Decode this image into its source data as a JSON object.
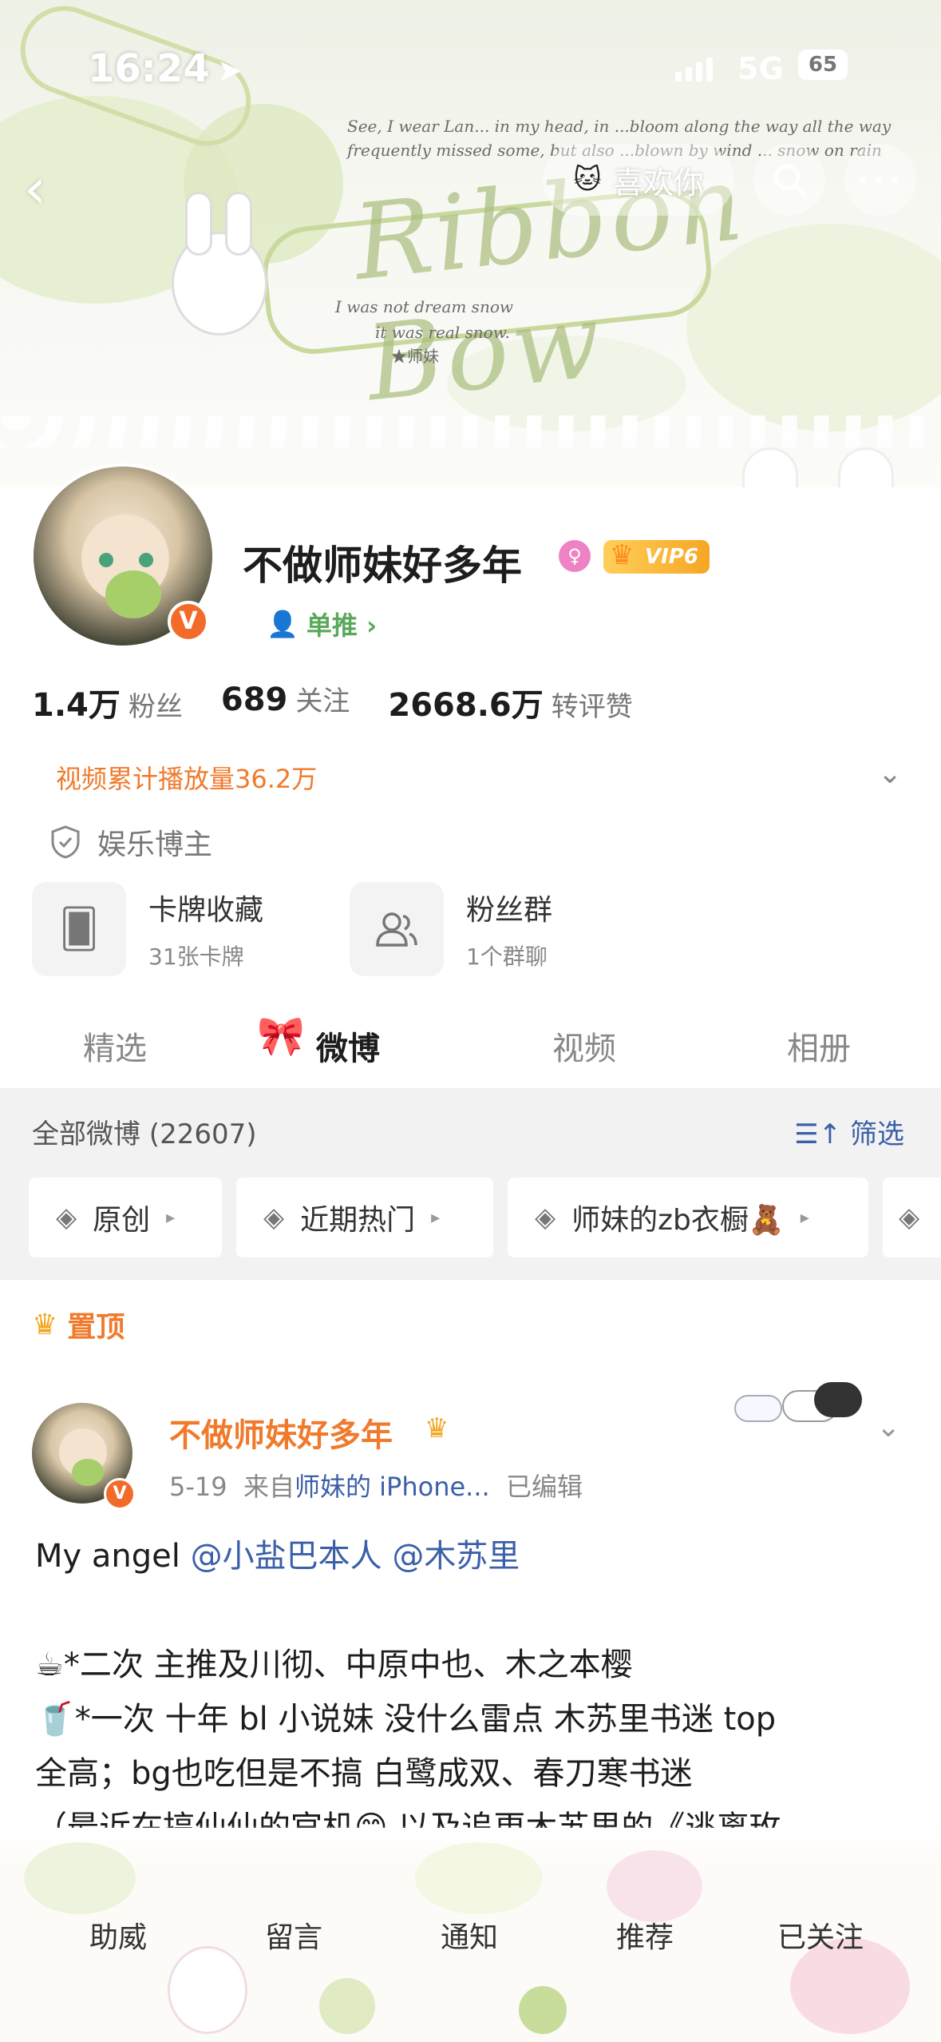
{
  "status_bar": {
    "time": "16:24",
    "network": "5G",
    "battery": "65"
  },
  "banner": {
    "title_art": "Ribbon Bow",
    "lines": [
      "See, I wear Lan... in my head, in ...bloom along the way all the way",
      "frequently missed some, but also ...blown by wind ... snow on rain",
      "I was not dream snow",
      "it was real snow.",
      "★师妹"
    ]
  },
  "top_nav": {
    "like_label": "喜欢你"
  },
  "profile": {
    "name": "不做师妹好多年",
    "gender_symbol": "♀",
    "vip_label": "VIP6",
    "single_label": "单推 ›",
    "stats": [
      {
        "num": "1.4万",
        "label": "粉丝"
      },
      {
        "num": "689",
        "label": "关注"
      },
      {
        "num": "2668.6万",
        "label": "转评赞"
      }
    ],
    "views_label": "视频累计播放量36.2万",
    "cert_label": "娱乐博主",
    "cards": [
      {
        "title": "卡牌收藏",
        "sub": "31张卡牌"
      },
      {
        "title": "粉丝群",
        "sub": "1个群聊"
      }
    ]
  },
  "tabs": [
    "精选",
    "微博",
    "视频",
    "相册"
  ],
  "feed": {
    "count_label": "全部微博 (22607)",
    "filter_label": "筛选",
    "chips": [
      "原创",
      "近期热门",
      "师妹的zb衣橱🧸"
    ]
  },
  "post": {
    "pin_label": "置顶",
    "author": "不做师妹好多年",
    "date": "5-19",
    "from_label": "来自",
    "source": "师妹的 iPhone...",
    "edited": "已编辑",
    "line1_pre": "My angel ",
    "mention1": "@小盐巴本人",
    "mention2": "@木苏里",
    "line2": "☕*二次 主推及川彻、中原中也、木之本樱",
    "line3": "🥤*一次 十年 bl 小说妹 没什么雷点 木苏里书迷 top",
    "line4": "全高；bg也吃但是不搞 白鹭成双、春刀寒书迷",
    "line5": "（最近在搞仙仙的官机😊 以及追更木苏里的《逃离玫"
  },
  "bottom_bar": [
    "助威",
    "留言",
    "通知",
    "推荐",
    "已关注"
  ]
}
